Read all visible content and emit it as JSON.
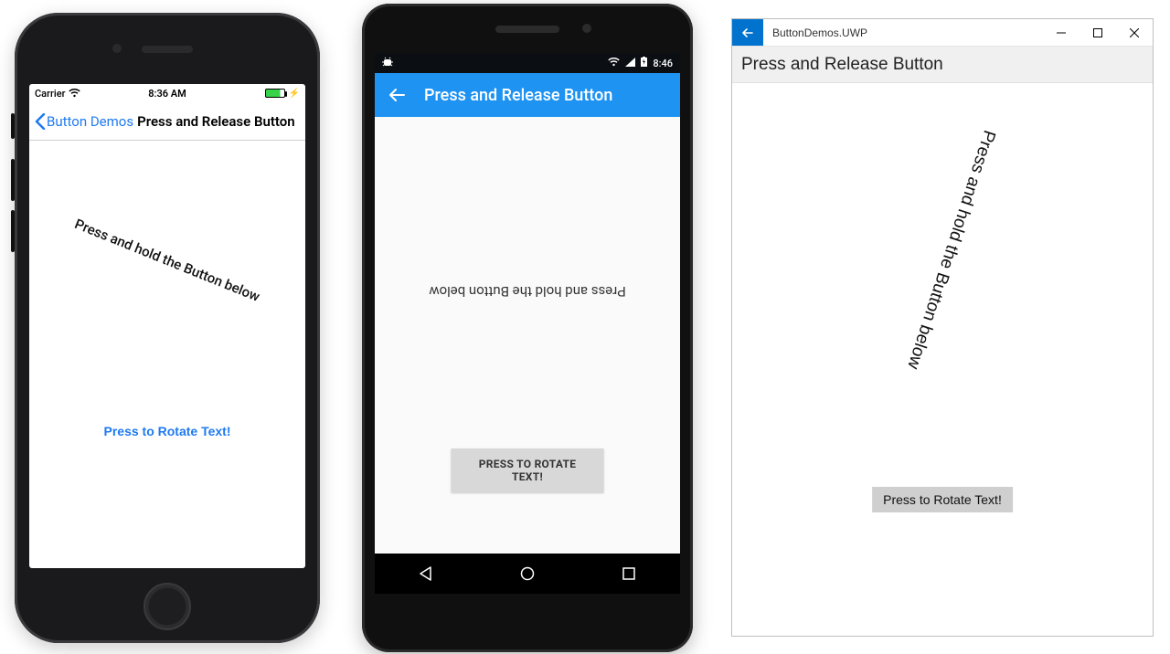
{
  "ios": {
    "status": {
      "carrier": "Carrier",
      "time": "8:36 AM"
    },
    "nav": {
      "back_label": "Button Demos",
      "title": "Press and Release Button"
    },
    "rot_text": "Press and hold the Button below",
    "rot_angle": 22,
    "button_label": "Press to Rotate Text!"
  },
  "android": {
    "status": {
      "time": "8:46"
    },
    "nav": {
      "title": "Press and Release Button"
    },
    "rot_text": "Press and hold the Button below",
    "rot_angle": 180,
    "button_label": "PRESS TO ROTATE TEXT!"
  },
  "uwp": {
    "titlebar": {
      "caption": "ButtonDemos.UWP"
    },
    "header": "Press and Release Button",
    "rot_text": "Press and hold the Button below",
    "rot_angle": 108,
    "button_label": "Press to Rotate Text!"
  },
  "colors": {
    "ios_accent": "#1f7af0",
    "android_accent": "#1f93f2",
    "uwp_accent": "#0173cf"
  }
}
